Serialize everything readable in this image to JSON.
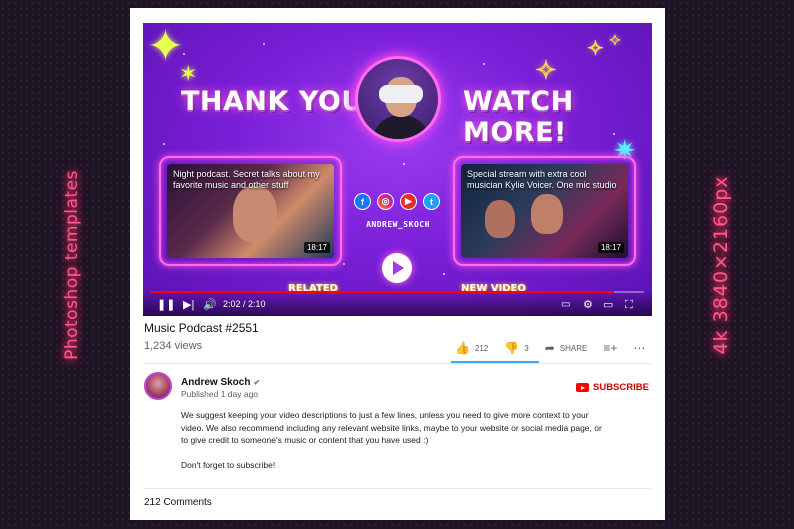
{
  "side_labels": {
    "left": "Photoshop templates",
    "right": "4k  3840×2160px"
  },
  "video": {
    "headline_left": "THANK YOU!",
    "headline_right": "WATCH MORE!",
    "cards": [
      {
        "title": "Night podcast. Secret talks about my favorite music and other stuff",
        "duration": "18:17"
      },
      {
        "title": "Special stream with extra cool musician Kylie Voicer. One mic studio",
        "duration": "18:17"
      }
    ],
    "socials": [
      "facebook-icon",
      "instagram-icon",
      "youtube-icon",
      "twitter-icon"
    ],
    "social_glyphs": {
      "facebook": "f",
      "instagram": "◎",
      "youtube": "▶",
      "twitter": "t"
    },
    "handle": "ANDREW_SKOCH",
    "label_related": "RELATED",
    "label_new": "NEW VIDEO",
    "time": "2:02 / 2:10",
    "progress": 0.94,
    "accent_color": "#ff0000"
  },
  "info": {
    "title": "Music Podcast #2551",
    "views": "1,234 views",
    "likes": "212",
    "dislikes": "3",
    "share": "SHARE"
  },
  "channel": {
    "name": "Andrew Skoch",
    "published": "Published 1 day ago",
    "subscribe": "SUBSCRIBE",
    "description": [
      "We suggest keeping your video descriptions to just a few lines, unless you need to give more context to your video. We also recommend including any relevant website links, maybe to your website or social media page, or to give credit to someone's music or content that you have used :)",
      "Don't forget to subscribe!"
    ]
  },
  "comments": "212 Comments"
}
